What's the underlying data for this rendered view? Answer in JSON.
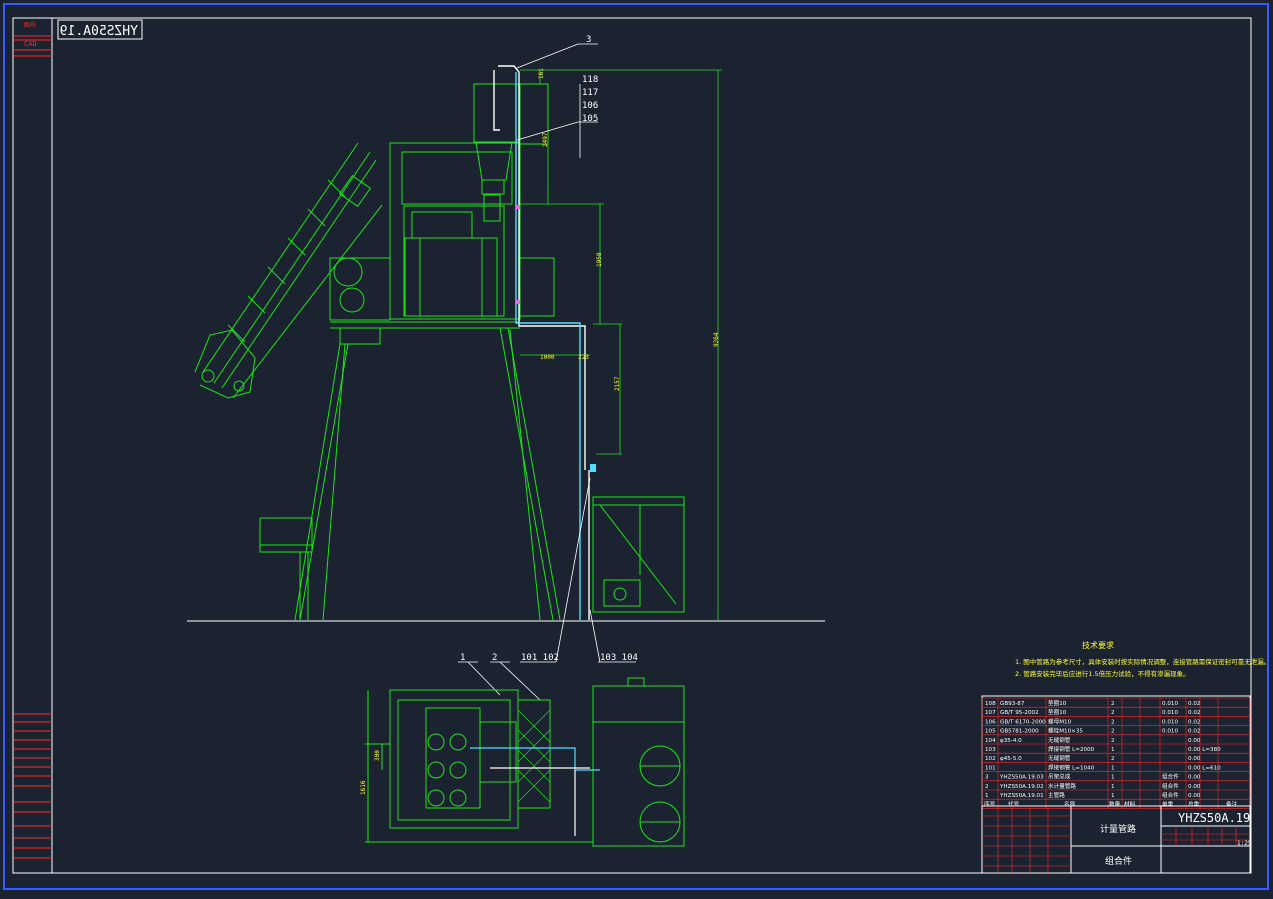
{
  "drawing": {
    "code": "YHZS50A.19",
    "mirror_code": "YHZS50A.19",
    "title": "计量管路",
    "subtitle": "组合件",
    "scale": "1:25",
    "left_strip": {
      "top_label_1": "图号",
      "top_label_2": "CAD"
    }
  },
  "tech_req": {
    "heading": "技术要求",
    "lines": [
      "1. 图中管路为参考尺寸，具体安装时按实际情况调整，连接管路需保证密封可靠无泄漏。",
      "2. 管路安装完毕后应进行1.5倍压力试验，不得有渗漏现象。"
    ]
  },
  "balloons": {
    "b3": "3",
    "b118": "118",
    "b117": "117",
    "b106": "106",
    "b105": "105",
    "b1": "1",
    "b2": "2",
    "b101_102": "101 102",
    "b103_104": "103 104"
  },
  "dims": {
    "d1": "161",
    "d2": "2497",
    "d3": "1958",
    "d4": "1000",
    "d5": "223",
    "d6": "2157",
    "d7": "9264",
    "d8": "300",
    "d9": "1616"
  },
  "bom": [
    {
      "no": "108",
      "code": "GB93-87",
      "name": "垫圈10",
      "qty": "2",
      "w1": "0.010",
      "w2": "0.02"
    },
    {
      "no": "107",
      "code": "GB/T 95-2002",
      "name": "垫圈10",
      "qty": "2",
      "w1": "0.010",
      "w2": "0.02"
    },
    {
      "no": "106",
      "code": "GB/T 6170-2000",
      "name": "螺母M10",
      "qty": "2",
      "w1": "0.010",
      "w2": "0.02"
    },
    {
      "no": "105",
      "code": "GB5781-2000",
      "name": "螺栓M10×35",
      "qty": "2",
      "w1": "0.010",
      "w2": "0.02"
    },
    {
      "no": "104",
      "code": "φ35-4.0",
      "name": "无缝钢管",
      "qty": "2",
      "w1": "",
      "w2": "0.00"
    },
    {
      "no": "103",
      "code": "",
      "name": "焊接钢管 L=2000",
      "qty": "1",
      "w1": "",
      "w2": "0.00 L=380"
    },
    {
      "no": "102",
      "code": "φ45-5.0",
      "name": "无缝钢管",
      "qty": "2",
      "w1": "",
      "w2": "0.00"
    },
    {
      "no": "101",
      "code": "",
      "name": "焊接钢管 L=1040",
      "qty": "1",
      "w1": "",
      "w2": "0.00 L=610"
    },
    {
      "no": "3",
      "code": "YHZS50A.19.03",
      "name": "吊架总成",
      "qty": "1",
      "w1": "组合件",
      "w2": "0.00"
    },
    {
      "no": "2",
      "code": "YHZS50A.19.02",
      "name": "水计量管路",
      "qty": "1",
      "w1": "组合件",
      "w2": "0.00"
    },
    {
      "no": "1",
      "code": "YHZS50A.19.01",
      "name": "主管路",
      "qty": "1",
      "w1": "组合件",
      "w2": "0.00"
    }
  ],
  "bom_header": {
    "no": "序号",
    "code": "代号",
    "name": "名称",
    "qty": "数量",
    "mat": "材料",
    "w1": "单重",
    "w2": "总重",
    "note": "备注"
  },
  "colors": {
    "bg": "#1b2230",
    "green": "#19e619",
    "yellow": "#ffff33",
    "red": "#ff2a2a",
    "white": "#ffffff",
    "cyan": "#4fe0ff",
    "blue": "#4a7dff"
  }
}
